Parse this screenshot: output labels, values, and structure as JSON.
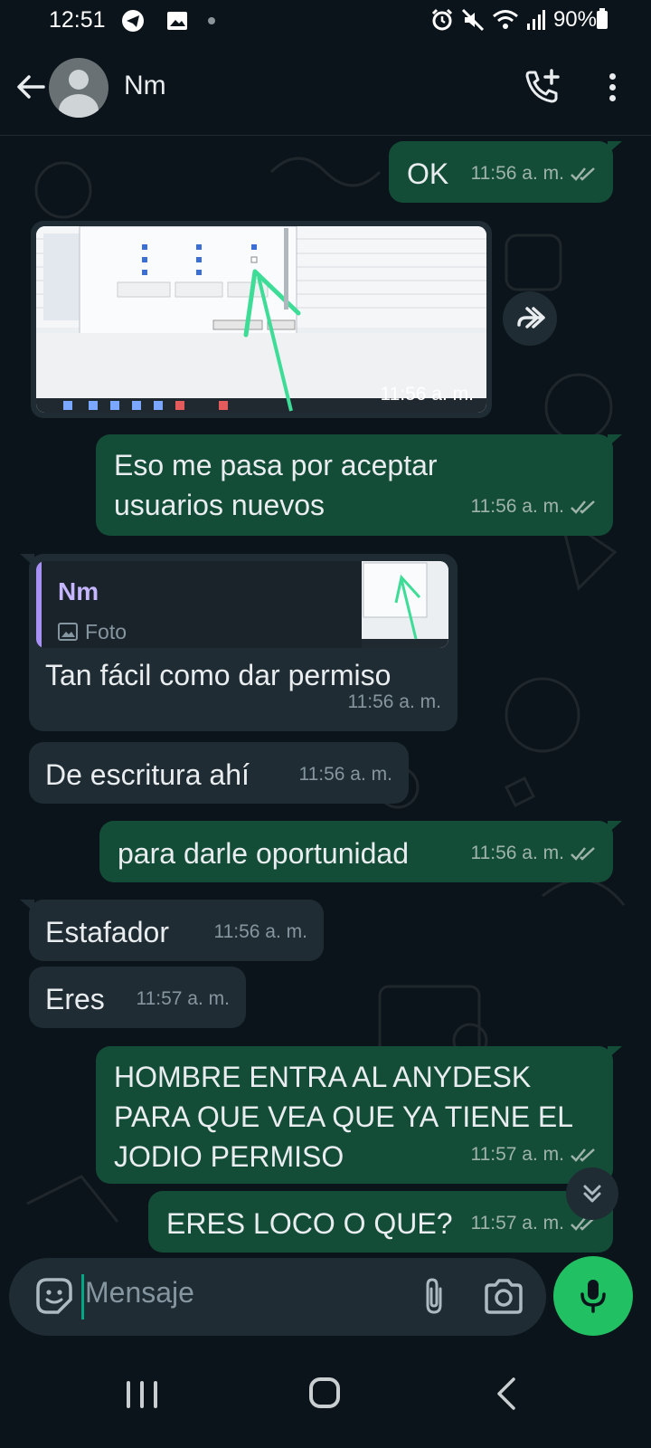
{
  "status_bar": {
    "time": "12:51",
    "battery": "90%"
  },
  "header": {
    "contact_name": "Nm"
  },
  "messages": [
    {
      "text": "OK",
      "time": "11:56 a. m."
    },
    {
      "time": "11:56 a. m."
    },
    {
      "text_line1": "Eso me pasa por aceptar",
      "text_line2": "usuarios nuevos",
      "time": "11:56 a. m."
    },
    {
      "quote_name": "Nm",
      "quote_type": "Foto",
      "text": "Tan fácil como dar permiso",
      "time": "11:56 a. m."
    },
    {
      "text": "De escritura ahí",
      "time": "11:56 a. m."
    },
    {
      "text": "para darle oportunidad",
      "time": "11:56 a. m."
    },
    {
      "text": "Estafador",
      "time": "11:56 a. m."
    },
    {
      "text": "Eres",
      "time": "11:57 a. m."
    },
    {
      "text_line1": "HOMBRE ENTRA AL ANYDESK",
      "text_line2": "PARA QUE VEA QUE YA TIENE EL",
      "text_line3": "JODIO PERMISO",
      "time": "11:57 a. m."
    },
    {
      "text": "ERES LOCO O QUE?",
      "time": "11:57 a. m."
    }
  ],
  "composer": {
    "placeholder": "Mensaje"
  },
  "colors": {
    "outgoing": "#144d37",
    "incoming": "#1f2c33",
    "accent": "#21c063",
    "quote_accent": "#a791f5"
  },
  "icons": [
    "telegram-icon",
    "gallery-icon",
    "alarm-icon",
    "mute-icon",
    "wifi-icon",
    "signal-icon",
    "battery-icon",
    "back-arrow-icon",
    "add-call-icon",
    "more-vert-icon",
    "forward-icon",
    "double-tick-icon",
    "emoji-icon",
    "attach-icon",
    "camera-icon",
    "mic-icon",
    "scroll-down-icon"
  ]
}
